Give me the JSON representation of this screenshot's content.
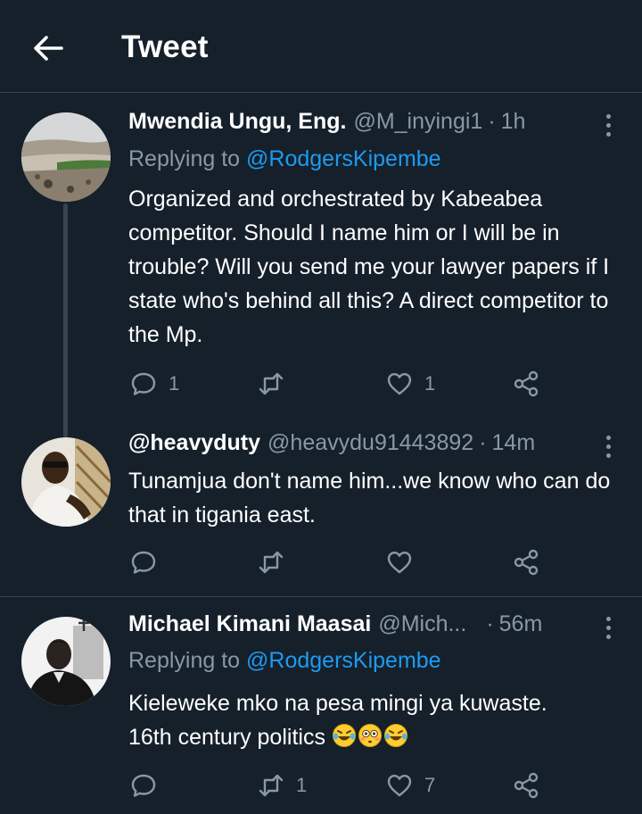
{
  "header": {
    "title": "Tweet"
  },
  "tweets": [
    {
      "name": "Mwendia Ungu, Eng.",
      "handle": "@M_inyingi1",
      "time": "1h",
      "replying_prefix": "Replying to",
      "replying_to": "@RodgersKipembe",
      "text": "Organized and orchestrated by Kabeabea competitor. Should I name him or I will be in trouble? Will you send me your lawyer papers if I state who's behind all this? A direct competitor to the Mp.",
      "replies": "1",
      "retweets": "",
      "likes": "1"
    },
    {
      "name": "@heavyduty",
      "handle": "@heavydu91443892",
      "time": "14m",
      "text": "Tunamjua don't name him...we know who can do that in tigania east.",
      "replies": "",
      "retweets": "",
      "likes": ""
    },
    {
      "name": "Michael Kimani Maasai",
      "handle": "@Mich...",
      "time": "56m",
      "replying_prefix": "Replying to",
      "replying_to": "@RodgersKipembe",
      "text": "Kieleweke mko na pesa mingi ya kuwaste.",
      "text2": "16th century politics",
      "emojis": [
        "rolling-on-floor-laughing",
        "flushed-face",
        "rolling-on-floor-laughing"
      ],
      "replies": "",
      "retweets": "1",
      "likes": "7"
    }
  ],
  "colors": {
    "background": "#15202b",
    "muted": "#8899a6",
    "link": "#1d9bf0",
    "divider": "#38444d"
  }
}
